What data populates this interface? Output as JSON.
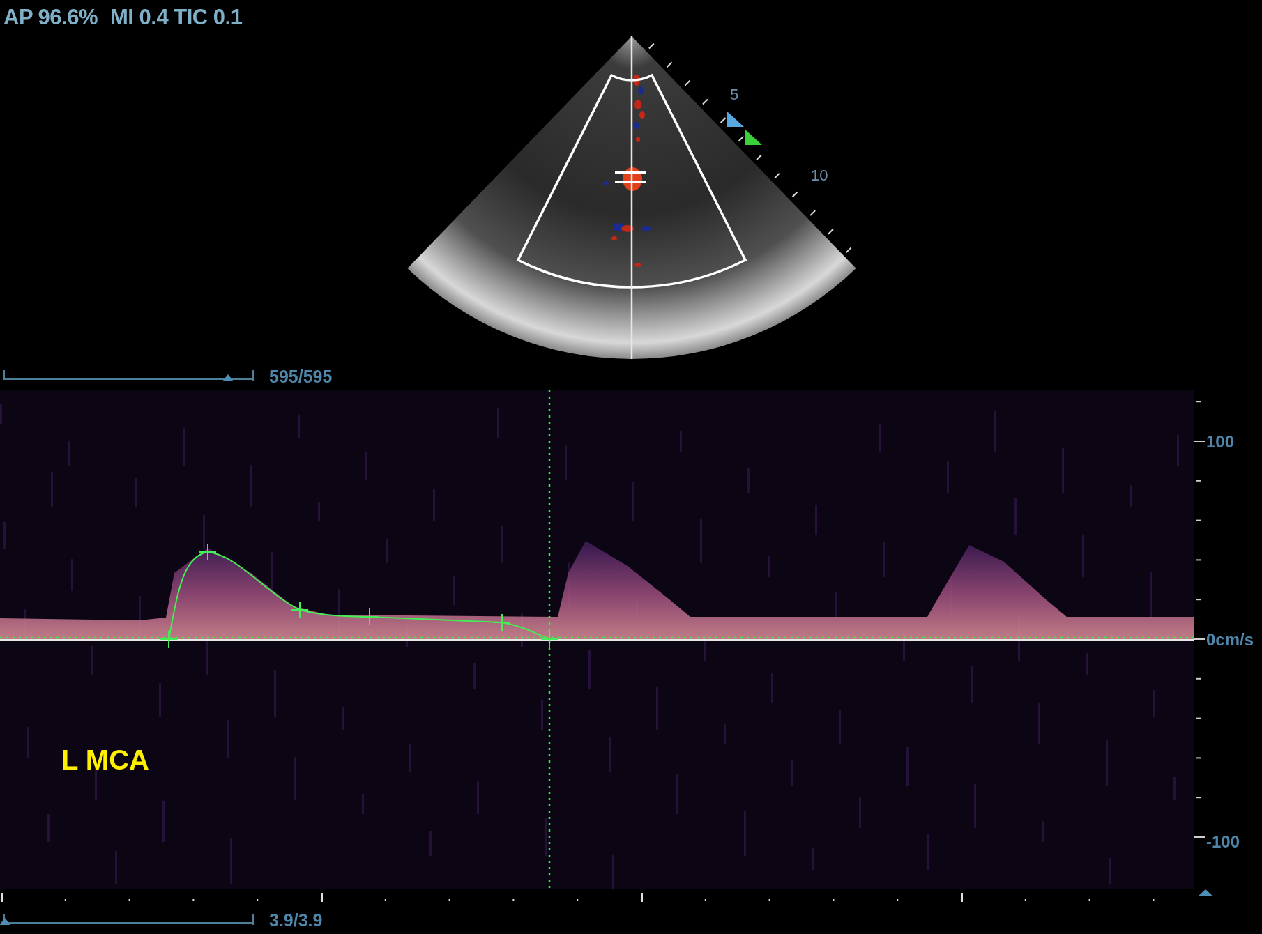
{
  "status": {
    "power": "AP 96.6%",
    "indices": "MI 0.4 TIC 0.1"
  },
  "image": {
    "depth_labels": [
      "5",
      "10"
    ]
  },
  "cine_slider": {
    "level": 0.9,
    "reading": "595/595"
  },
  "doppler": {
    "scale_labels": [
      "100",
      "0cm/s",
      "-100"
    ],
    "vessel_label": "L MCA"
  },
  "time_slider": {
    "level": 0,
    "reading": "3.9/3.9"
  }
}
